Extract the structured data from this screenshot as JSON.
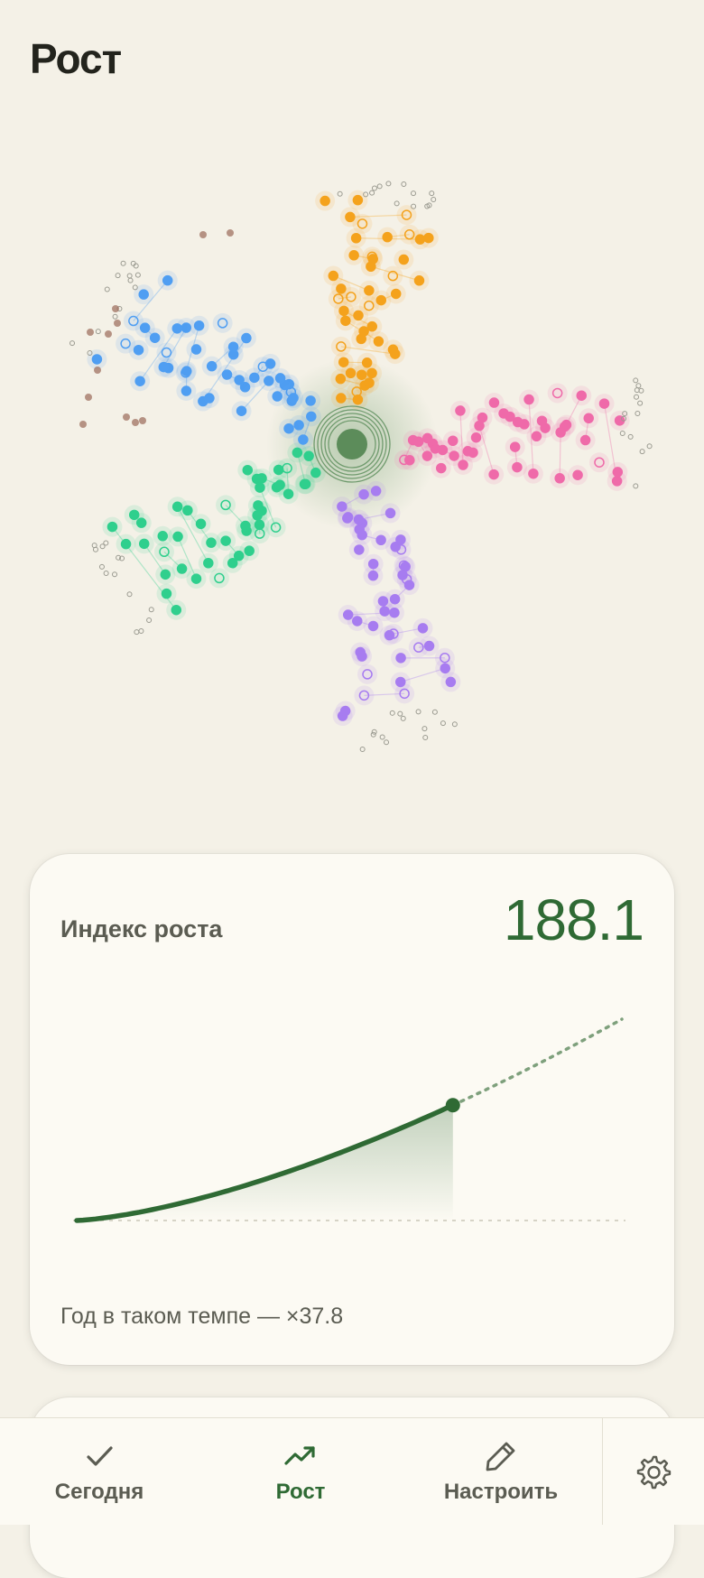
{
  "header": {
    "title": "Рост"
  },
  "growth_card": {
    "label": "Индекс роста",
    "value": "188.1",
    "footnote": "Год в таком темпе — ×37.8",
    "accent_color": "#2f6a34",
    "trend_progress": 0.69
  },
  "tabs": [
    {
      "label": "Сегодня",
      "icon": "check-icon",
      "active": false
    },
    {
      "label": "Рост",
      "icon": "trending-up-icon",
      "active": true
    },
    {
      "label": "Настроить",
      "icon": "pencil-icon",
      "active": false
    }
  ],
  "settings": {
    "icon": "gear-icon"
  },
  "branch_colors": [
    "#f4a21c",
    "#ef6aa9",
    "#a77cf0",
    "#2fcf8d",
    "#4f9ef2",
    "#9a6a58"
  ]
}
